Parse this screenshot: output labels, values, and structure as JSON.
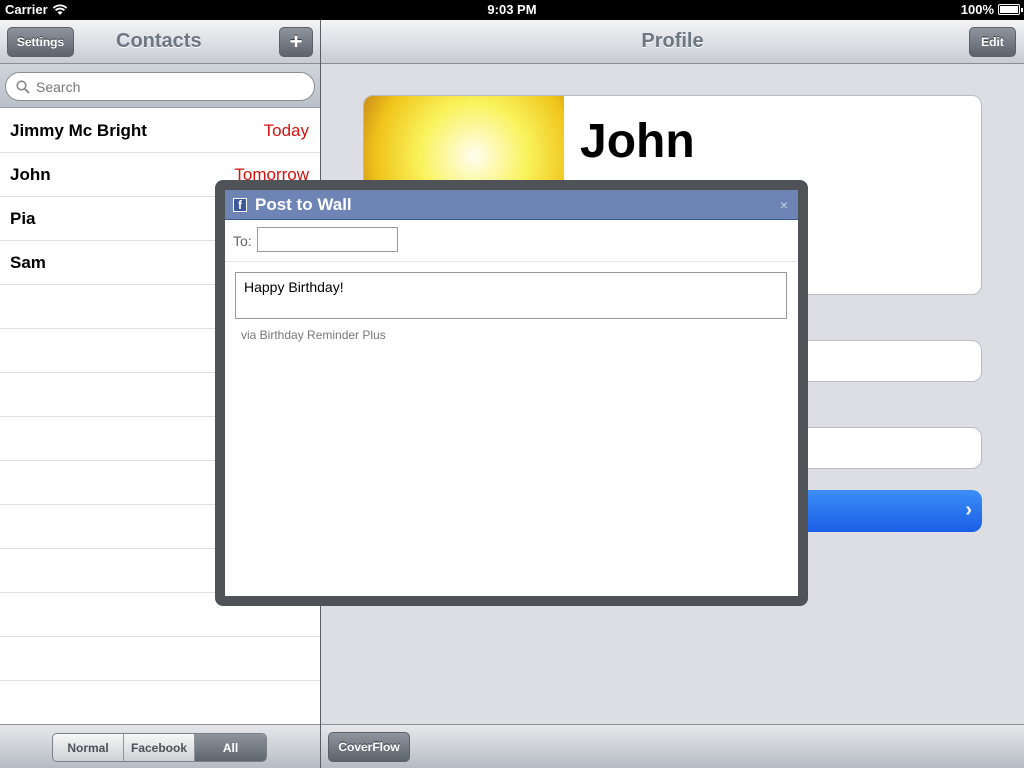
{
  "status_bar": {
    "carrier": "Carrier",
    "time": "9:03 PM",
    "battery": "100%"
  },
  "left_pane": {
    "title": "Contacts",
    "settings_label": "Settings",
    "add_label": "+",
    "search": {
      "placeholder": "Search"
    },
    "contacts": [
      {
        "name": "Jimmy Mc Bright",
        "day": "Today"
      },
      {
        "name": "John",
        "day": "Tomorrow"
      },
      {
        "name": "Pia",
        "day": ""
      },
      {
        "name": "Sam",
        "day": ""
      }
    ],
    "filter": {
      "options": [
        "Normal",
        "Facebook",
        "All"
      ],
      "selected": "All"
    }
  },
  "right_pane": {
    "title": "Profile",
    "edit_label": "Edit",
    "profile_name": "John",
    "coverflow_label": "CoverFlow"
  },
  "dialog": {
    "title": "Post to Wall",
    "close": "×",
    "to_label": "To:",
    "to_value": "",
    "message": "Happy Birthday!",
    "via": "via Birthday Reminder Plus"
  },
  "colors": {
    "facebook_header": "#6d84b4",
    "date_red": "#d4120d",
    "action_blue": "#1a5ee6"
  }
}
